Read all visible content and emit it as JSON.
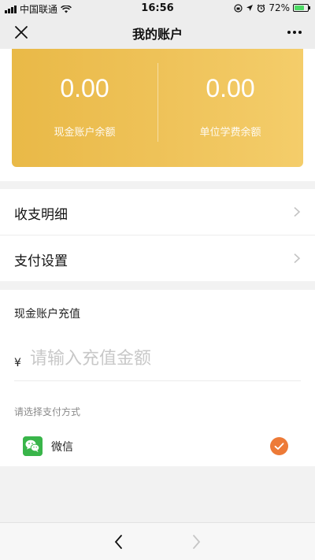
{
  "status_bar": {
    "carrier": "中国联通",
    "time": "16:56",
    "battery_percent": "72%",
    "battery_level": 0.72,
    "icons": [
      "signal-icon",
      "wifi-icon",
      "location-lock-icon",
      "location-arrow-icon",
      "alarm-icon",
      "battery-icon"
    ]
  },
  "nav": {
    "title": "我的账户",
    "close_icon": "close-icon",
    "more_icon": "more-icon"
  },
  "balances": {
    "cash": {
      "value": "0.00",
      "label": "现金账户余额"
    },
    "unit": {
      "value": "0.00",
      "label": "单位学费余额"
    }
  },
  "menu": {
    "items": [
      {
        "label": "收支明细"
      },
      {
        "label": "支付设置"
      }
    ]
  },
  "recharge": {
    "title": "现金账户充值",
    "currency": "¥",
    "placeholder": "请输入充值金额",
    "value": "",
    "pay_method_title": "请选择支付方式",
    "options": [
      {
        "label": "微信",
        "selected": true
      }
    ]
  },
  "colors": {
    "card_start": "#e9b947",
    "card_end": "#f4cd6a",
    "check": "#ed7a37",
    "wechat": "#39b54a"
  },
  "bottom_bar": {
    "back_icon": "back-arrow-icon",
    "forward_icon": "forward-arrow-icon"
  }
}
